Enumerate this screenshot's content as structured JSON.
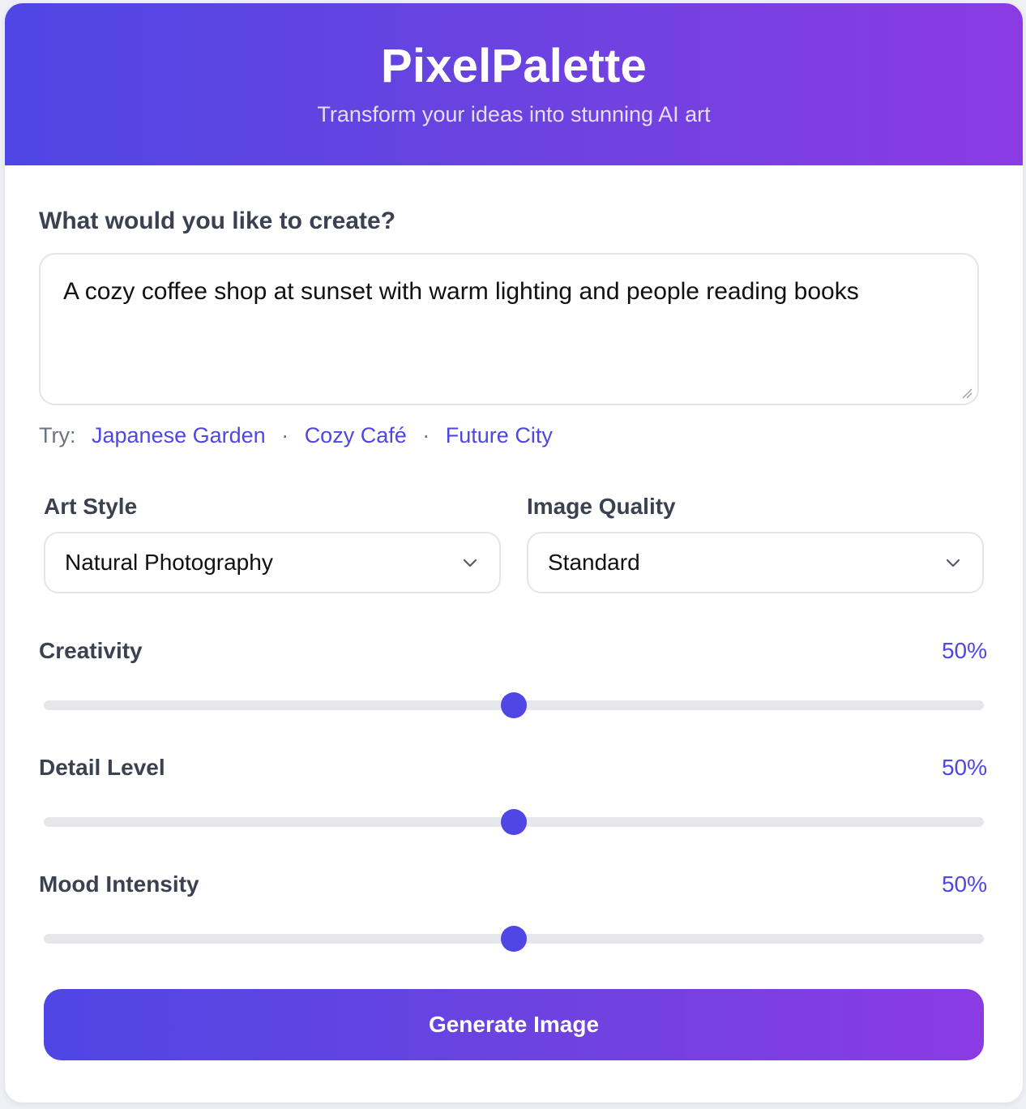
{
  "header": {
    "title": "PixelPalette",
    "subtitle": "Transform your ideas into stunning AI art"
  },
  "prompt": {
    "label": "What would you like to create?",
    "value": "A cozy coffee shop at sunset with warm lighting and people reading books"
  },
  "suggestions": {
    "prefix": "Try:",
    "separator": "·",
    "items": [
      "Japanese Garden",
      "Cozy Café",
      "Future City"
    ]
  },
  "art_style": {
    "label": "Art Style",
    "selected": "Natural Photography"
  },
  "image_quality": {
    "label": "Image Quality",
    "selected": "Standard"
  },
  "sliders": [
    {
      "label": "Creativity",
      "value_text": "50%",
      "value": 0.5
    },
    {
      "label": "Detail Level",
      "value_text": "50%",
      "value": 0.5
    },
    {
      "label": "Mood Intensity",
      "value_text": "50%",
      "value": 0.5
    }
  ],
  "generate_button": {
    "label": "Generate Image"
  },
  "colors": {
    "accent": "#4f46e5",
    "gradient_end": "#8b3be3"
  }
}
